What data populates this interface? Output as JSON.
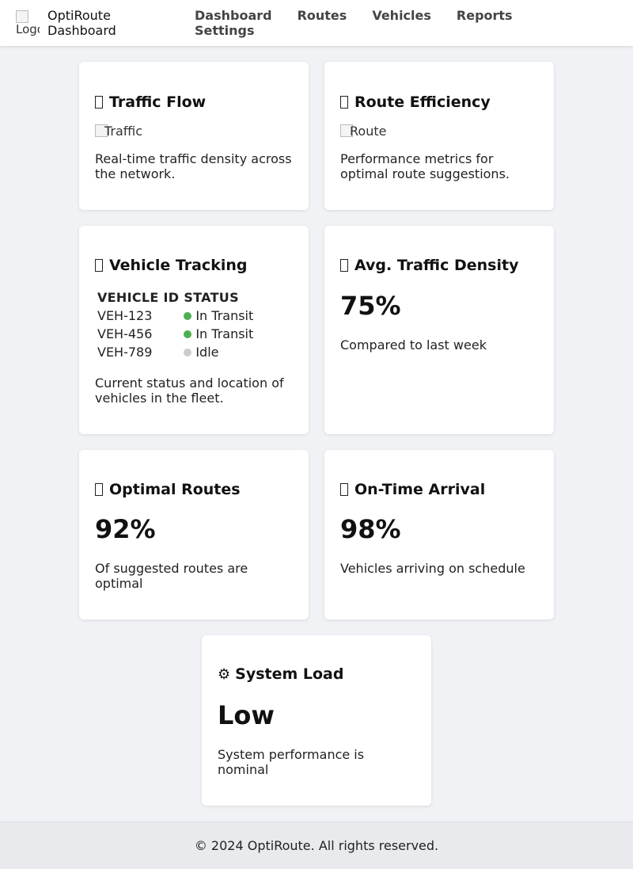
{
  "header": {
    "logo_alt": "Logo",
    "brand": "OptiRoute Dashboard",
    "nav": [
      "Dashboard",
      "Routes",
      "Vehicles",
      "Reports",
      "Settings"
    ]
  },
  "cards": {
    "traffic_flow": {
      "icon": "traffic-icon",
      "title": "Traffic Flow",
      "image_alt": "Traffic",
      "description": "Real-time traffic density across the network."
    },
    "route_efficiency": {
      "icon": "route-icon",
      "title": "Route Efficiency",
      "image_alt": "Route",
      "description": "Performance metrics for optimal route suggestions."
    },
    "vehicle_tracking": {
      "icon": "vehicle-icon",
      "title": "Vehicle Tracking",
      "columns": [
        "VEHICLE ID",
        "STATUS"
      ],
      "rows": [
        {
          "id": "VEH-123",
          "status": "In Transit",
          "color": "#4caf50"
        },
        {
          "id": "VEH-456",
          "status": "In Transit",
          "color": "#4caf50"
        },
        {
          "id": "VEH-789",
          "status": "Idle",
          "color": "#cccccc"
        }
      ],
      "description": "Current status and location of vehicles in the fleet."
    },
    "avg_density": {
      "icon": "density-icon",
      "title": "Avg. Traffic Density",
      "value": "75%",
      "description": "Compared to last week"
    },
    "optimal_routes": {
      "icon": "optimal-route-icon",
      "title": "Optimal Routes",
      "value": "92%",
      "description": "Of suggested routes are optimal"
    },
    "on_time": {
      "icon": "clock-icon",
      "title": "On-Time Arrival",
      "value": "98%",
      "description": "Vehicles arriving on schedule"
    },
    "system_load": {
      "icon": "gear-icon",
      "icon_glyph": "⚙",
      "title": "System Load",
      "value": "Low",
      "description": "System performance is nominal"
    }
  },
  "footer": {
    "text": "© 2024 OptiRoute. All rights reserved."
  }
}
